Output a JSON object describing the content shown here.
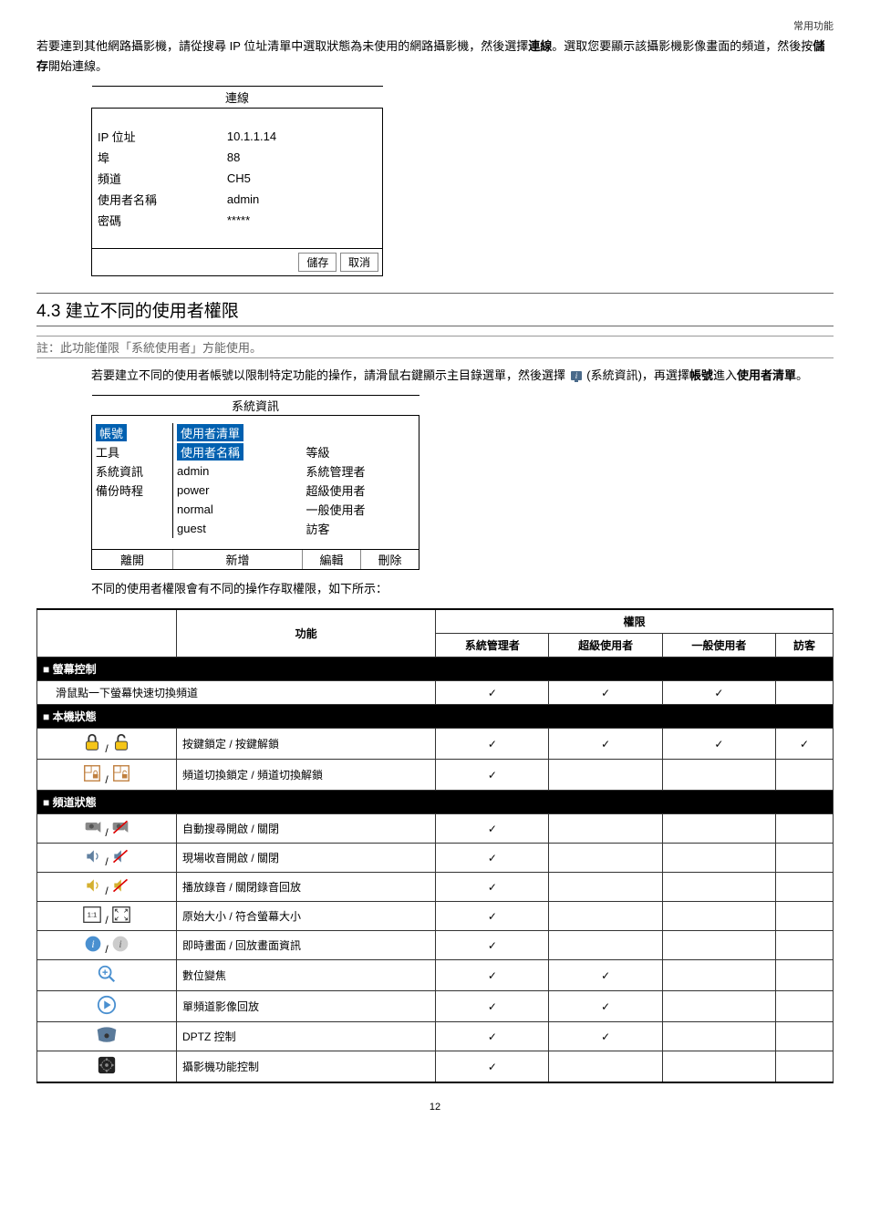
{
  "header": {
    "breadcrumb": "常用功能"
  },
  "intro": {
    "line1a": "若要連到其他網路攝影機，請從搜尋 IP 位址清單中選取狀態為未使用的網路攝影機，然後選擇",
    "line1b": "連線",
    "line1c": "。選取您要顯示該攝影機影像畫面的頻道，然後按",
    "line1d": "儲存",
    "line1e": "開始連線。"
  },
  "conn": {
    "title": "連線",
    "rows": {
      "ip_label": "IP 位址",
      "ip_val": "10.1.1.14",
      "port_label": "埠",
      "port_val": "88",
      "ch_label": "頻道",
      "ch_val": "CH5",
      "user_label": "使用者名稱",
      "user_val": "admin",
      "pw_label": "密碼",
      "pw_val": "*****"
    },
    "save": "儲存",
    "cancel": "取消"
  },
  "section43": {
    "title": "4.3  建立不同的使用者權限"
  },
  "note": "註：此功能僅限「系統使用者」方能使用。",
  "body43": {
    "p1a": "若要建立不同的使用者帳號以限制特定功能的操作，請滑鼠右鍵顯示主目錄選單，然後選擇 ",
    "p1b": " (系統資訊)，再選擇",
    "p1c": "帳號",
    "p1d": "進入",
    "p1e": "使用者清單",
    "p1f": "。"
  },
  "sysinfo": {
    "title": "系統資訊",
    "left": {
      "account": "帳號",
      "tool": "工具",
      "sys": "系統資訊",
      "backup": "備份時程"
    },
    "mid_header": "使用者清單",
    "col1": "使用者名稱",
    "col2": "等級",
    "rows": [
      {
        "name": "admin",
        "level": "系統管理者"
      },
      {
        "name": "power",
        "level": "超級使用者"
      },
      {
        "name": "normal",
        "level": "一般使用者"
      },
      {
        "name": "guest",
        "level": "訪客"
      }
    ],
    "footer": {
      "leave": "離開",
      "add": "新增",
      "edit": "編輯",
      "del": "刪除"
    }
  },
  "perm_intro": "不同的使用者權限會有不同的操作存取權限，如下所示：",
  "perm": {
    "h_func": "功能",
    "h_perm": "權限",
    "h_admin": "系統管理者",
    "h_power": "超級使用者",
    "h_normal": "一般使用者",
    "h_guest": "訪客",
    "s_screen": "■ 螢幕控制",
    "r_mouse": "滑鼠點一下螢幕快速切換頻道",
    "s_local": "■ 本機狀態",
    "r_keylock": "按鍵鎖定 / 按鍵解鎖",
    "r_chlock": "頻道切換鎖定 / 頻道切換解鎖",
    "s_ch": "■ 頻道狀態",
    "r_autosearch": "自動搜尋開啟 / 關閉",
    "r_liveaudio": "現場收音開啟 / 關閉",
    "r_playaudio": "播放錄音 / 關閉錄音回放",
    "r_size": "原始大小 / 符合螢幕大小",
    "r_info": "即時畫面 / 回放畫面資訊",
    "r_zoom": "數位變焦",
    "r_playback": "單頻道影像回放",
    "r_dptz": "DPTZ 控制",
    "r_cam": "攝影機功能控制"
  },
  "page": "12"
}
